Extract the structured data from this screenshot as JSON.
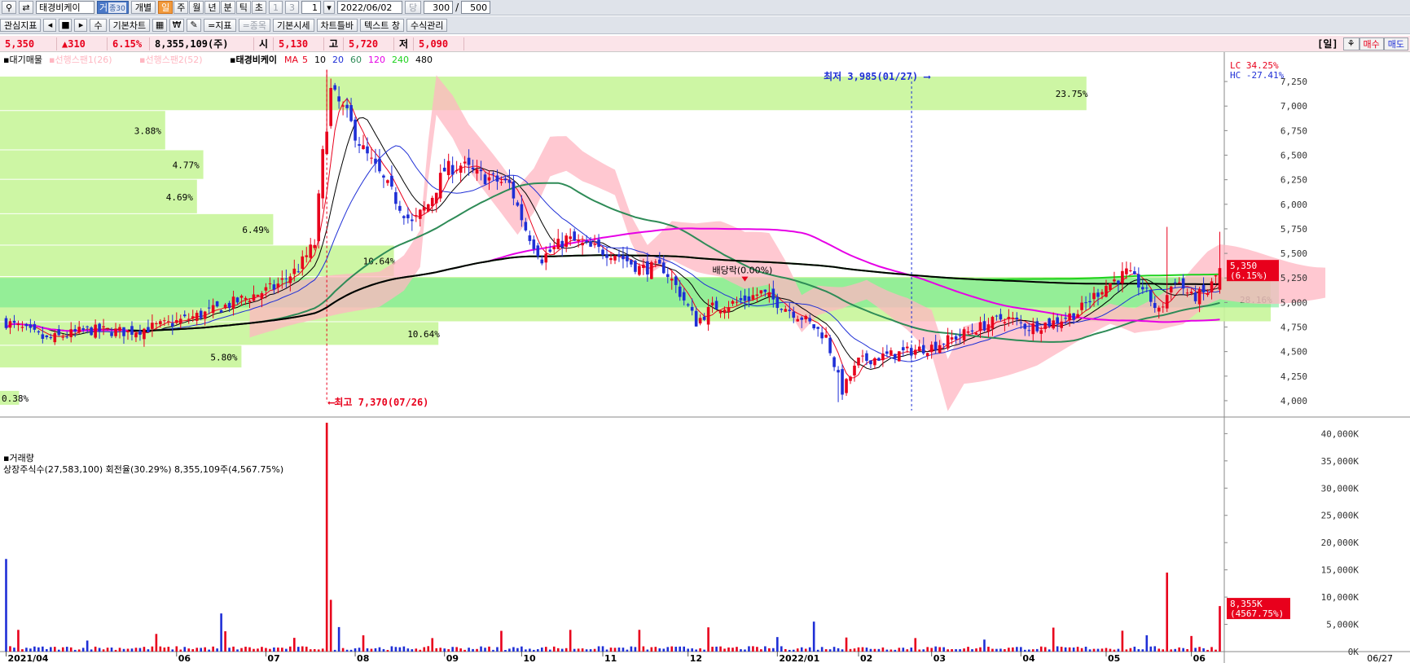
{
  "toolbar1": {
    "stock_name": "태경비케이",
    "tag_main": "거",
    "tag_sub": "종30",
    "mode": "개별",
    "period_tabs": [
      "일",
      "주",
      "월",
      "년",
      "분",
      "틱",
      "초"
    ],
    "active_tab": "일",
    "unit_a": "1",
    "unit_b": "3",
    "unit_sel": "1",
    "date": "2022/06/02",
    "dang": "당",
    "count": "300",
    "slash": "/",
    "max": "500"
  },
  "toolbar2": {
    "items": [
      "관심지표",
      "기본차트",
      "=지표",
      "=종목",
      "기본시세",
      "차트틀바",
      "텍스트 창",
      "수식관리"
    ],
    "su": "수"
  },
  "price": {
    "current": "5,350",
    "change": "▲310",
    "rate": "6.15%",
    "volume": "8,355,109(주)",
    "open_label": "시",
    "open": "5,130",
    "high_label": "고",
    "high": "5,720",
    "low_label": "저",
    "low": "5,090",
    "period": "[일]",
    "buy": "매수",
    "sell": "매도"
  },
  "legend": {
    "main": [
      "대기매물",
      "선행스팬1(26)",
      "선행스팬2(52)",
      "태경비케이"
    ],
    "ma_label": "MA",
    "ma": [
      {
        "label": "5",
        "color": "#e8001c"
      },
      {
        "label": "10",
        "color": "#000000"
      },
      {
        "label": "20",
        "color": "#1f2fd6"
      },
      {
        "label": "60",
        "color": "#2e8b57"
      },
      {
        "label": "120",
        "color": "#e600e6"
      },
      {
        "label": "240",
        "color": "#1ed21e"
      },
      {
        "label": "480",
        "color": "#000000"
      }
    ]
  },
  "side": {
    "lc": "LC  34.25%",
    "hc": "HC -27.41%",
    "price_tag": "5,350",
    "price_tag2": "(6.15%)",
    "vol_tag": "8,355K",
    "vol_tag2": "(4567.75%)",
    "date_corner": "06/27"
  },
  "volume_panel": {
    "title": "거래량",
    "info": "상장주식수(27,583,100) 회전율(30.29%) 8,355,109주(4,567.75%)"
  },
  "chart_data": {
    "type": "candlestick",
    "price_axis": {
      "min": 3900,
      "max": 7400,
      "ticks": [
        4000,
        4250,
        4500,
        4750,
        5000,
        5250,
        5500,
        5750,
        6000,
        6250,
        6500,
        6750,
        7000,
        7250
      ],
      "labels": [
        "4,000",
        "4,250",
        "4,500",
        "4,750",
        "5,000",
        "5,250",
        "5,500",
        "5,750",
        "6,000",
        "6,250",
        "6,500",
        "6,750",
        "7,000",
        "7,250"
      ]
    },
    "volume_axis": {
      "min": 0,
      "max": 42000,
      "ticks": [
        0,
        5000,
        10000,
        15000,
        20000,
        25000,
        30000,
        35000,
        40000
      ],
      "labels": [
        "0K",
        "5,000K",
        "10,000K",
        "15,000K",
        "20,000K",
        "25,000K",
        "30,000K",
        "35,000K",
        "40,000K"
      ]
    },
    "x_labels": [
      {
        "label": "2021/04",
        "day": 0
      },
      {
        "label": "06",
        "day": 42
      },
      {
        "label": "07",
        "day": 64
      },
      {
        "label": "08",
        "day": 86
      },
      {
        "label": "09",
        "day": 108
      },
      {
        "label": "10",
        "day": 127
      },
      {
        "label": "11",
        "day": 147
      },
      {
        "label": "12",
        "day": 168
      },
      {
        "label": "2022/01",
        "day": 190
      },
      {
        "label": "02",
        "day": 210
      },
      {
        "label": "03",
        "day": 228
      },
      {
        "label": "04",
        "day": 250
      },
      {
        "label": "05",
        "day": 271
      },
      {
        "label": "06",
        "day": 292
      }
    ],
    "volume_profile": [
      {
        "low": 3950,
        "high": 4100,
        "strength": 0.015,
        "label": "0.38%"
      },
      {
        "low": 4330,
        "high": 4560,
        "strength": 0.19,
        "label": "5.80%"
      },
      {
        "low": 4560,
        "high": 4800,
        "strength": 0.345,
        "label": "10.64%"
      },
      {
        "low": 4800,
        "high": 5260,
        "strength": 1.0,
        "label": "28.16%"
      },
      {
        "low": 5260,
        "high": 5580,
        "strength": 0.31,
        "label": "10.64%"
      },
      {
        "low": 5580,
        "high": 5900,
        "strength": 0.215,
        "label": "6.49%"
      },
      {
        "low": 5900,
        "high": 6250,
        "strength": 0.155,
        "label": "4.69%"
      },
      {
        "low": 6250,
        "high": 6550,
        "strength": 0.16,
        "label": "4.77%"
      },
      {
        "low": 6550,
        "high": 6950,
        "strength": 0.13,
        "label": "3.88%"
      },
      {
        "low": 6950,
        "high": 7300,
        "strength": 0.855,
        "label": "23.75%"
      }
    ],
    "annotations": [
      {
        "text": "최저 3,985(01/27)",
        "day": 203,
        "price": 3985
      },
      {
        "text": "최고 7,370(07/26)",
        "day": 79,
        "price": 7370
      },
      {
        "text": "배당락(0.00%)",
        "day": 182,
        "price": 5180
      }
    ],
    "last_volume": 8355
  }
}
